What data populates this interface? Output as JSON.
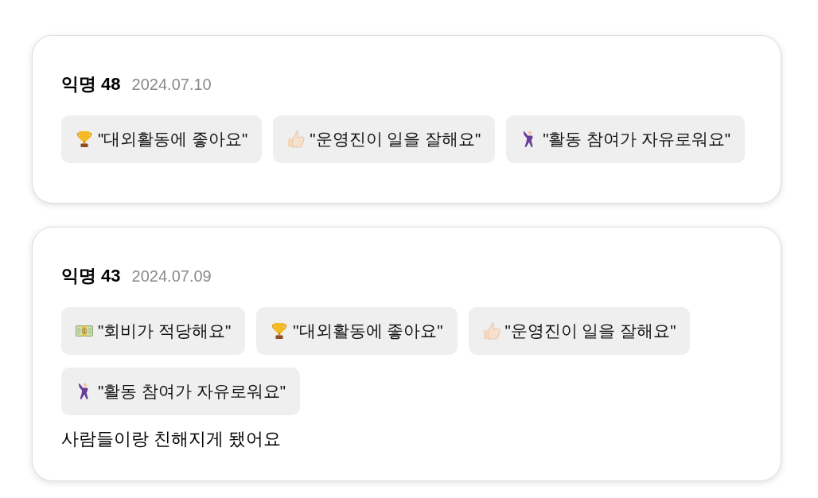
{
  "reviews": [
    {
      "author": "익명 48",
      "date": "2024.07.10",
      "tags": [
        {
          "kind": "trophy",
          "label": "\"대외활동에 좋아요\""
        },
        {
          "kind": "thumbs-up",
          "label": "\"운영진이 일을 잘해요\""
        },
        {
          "kind": "dancer",
          "label": "\"활동 참여가 자유로워요\""
        }
      ]
    },
    {
      "author": "익명 43",
      "date": "2024.07.09",
      "tags": [
        {
          "kind": "banknote",
          "label": "\"회비가 적당해요\""
        },
        {
          "kind": "trophy",
          "label": "\"대외활동에 좋아요\""
        },
        {
          "kind": "thumbs-up",
          "label": "\"운영진이 일을 잘해요\""
        },
        {
          "kind": "dancer",
          "label": "\"활동 참여가 자유로워요\""
        }
      ],
      "comment": "사람들이랑 친해지게 됐어요"
    }
  ]
}
